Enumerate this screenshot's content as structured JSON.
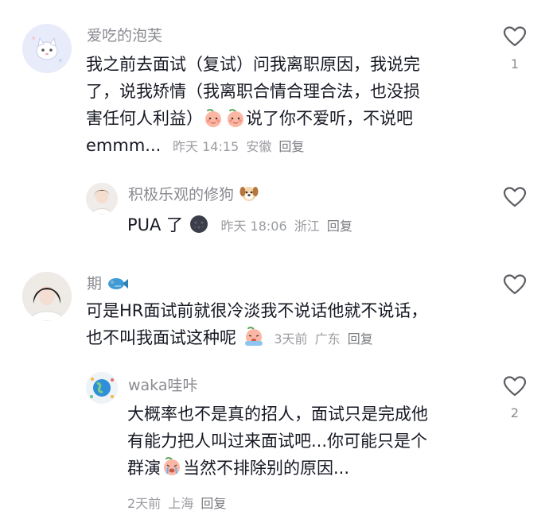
{
  "comments": [
    {
      "username": "爱吃的泡芙",
      "text_lines": [
        "我之前去面试（复试）问我离职原因，我说完",
        "了，说我矫情（我离职合情合理合法，也没损",
        "害任何人利益）",
        "说了你不爱听，不说吧"
      ],
      "text_tail": "emmm...",
      "time": "昨天 14:15",
      "location": "安徽",
      "reply": "回复",
      "likes": "1",
      "avatar_icon": "white-cat-avatar",
      "emoji_icon": "peach-face-emoji"
    },
    {
      "username": "积极乐观的修狗",
      "username_emoji": "dog-face-emoji",
      "text": "PUA 了",
      "text_emoji": "dark-moon-face-emoji",
      "time": "昨天 18:06",
      "location": "浙江",
      "reply": "回复",
      "likes": "",
      "avatar_icon": "girl-photo-avatar"
    },
    {
      "username": "期",
      "username_emoji": "fish-emoji",
      "text_lines": [
        "可是HR面试前就很冷淡我不说话他就不说话，",
        "也不叫我面试这种呢"
      ],
      "text_emoji": "crying-peach-emoji",
      "time": "3天前",
      "location": "广东",
      "reply": "回复",
      "likes": "",
      "avatar_icon": "woman-portrait-avatar"
    },
    {
      "username": "waka哇咔",
      "text_lines": [
        "大概率也不是真的招人，面试只是完成他",
        "有能力把人叫过来面试吧...你可能只是个",
        "群演",
        "当然不排除别的原因..."
      ],
      "text_emoji": "sobbing-peach-emoji",
      "time": "2天前",
      "location": "上海",
      "reply": "回复",
      "likes": "2",
      "avatar_icon": "globe-avatar"
    }
  ],
  "colors": {
    "text": "#161823",
    "username": "#8a8b91",
    "meta": "#9b9ca1",
    "heart": "#5c5d63"
  }
}
